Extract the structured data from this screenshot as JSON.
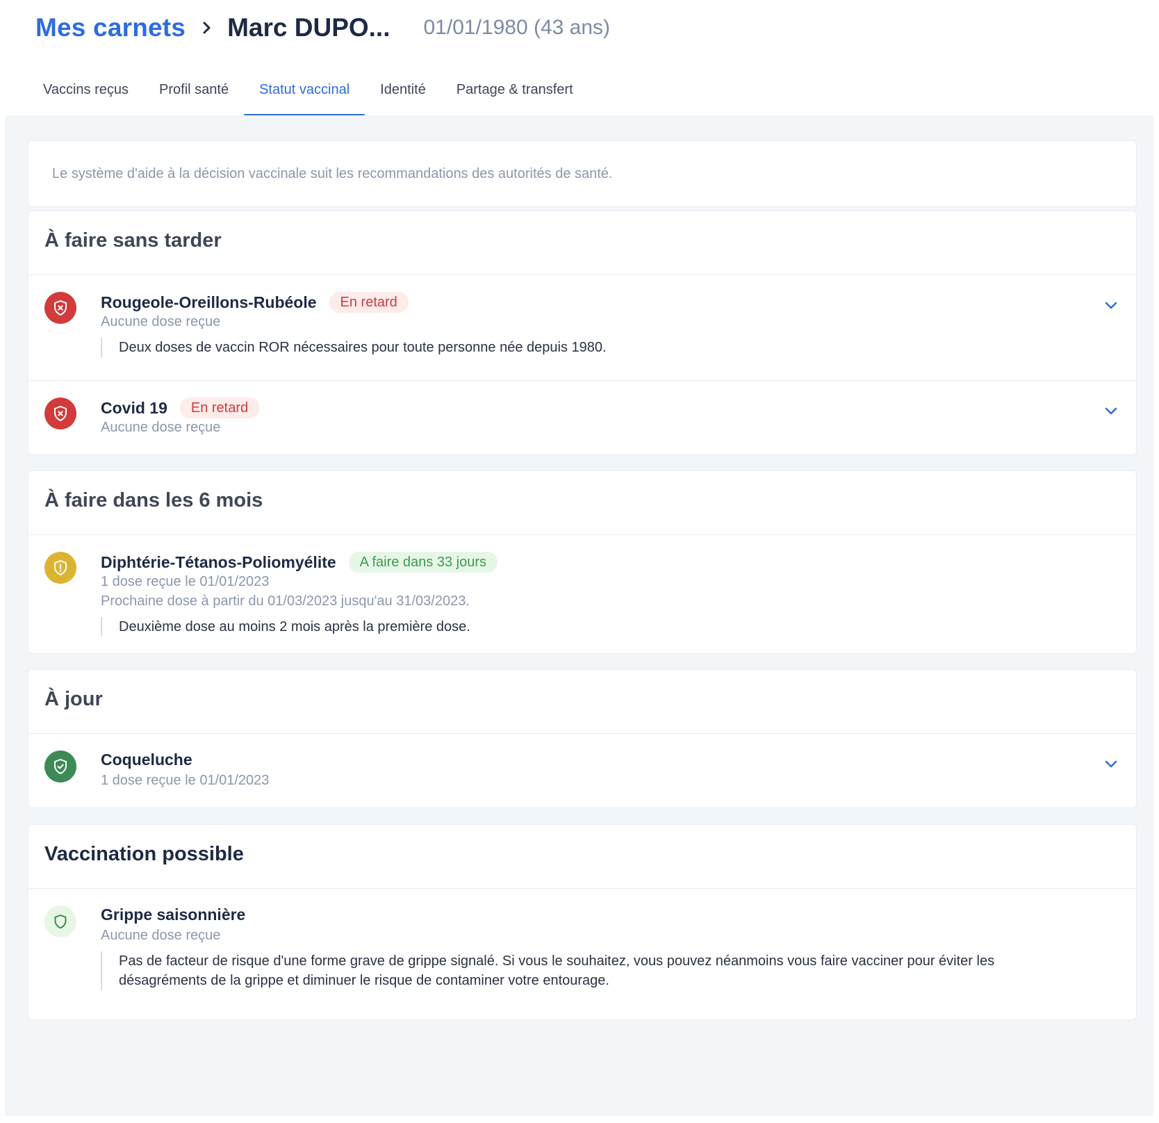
{
  "breadcrumb": {
    "root_label": "Mes carnets",
    "current_label": "Marc DUPO...",
    "birth_info": "01/01/1980 (43 ans)"
  },
  "tabs": [
    {
      "label": "Vaccins reçus",
      "active": false
    },
    {
      "label": "Profil santé",
      "active": false
    },
    {
      "label": "Statut vaccinal",
      "active": true
    },
    {
      "label": "Identité",
      "active": false
    },
    {
      "label": "Partage & transfert",
      "active": false
    }
  ],
  "info": {
    "text": "Le système d'aide à la décision vaccinale suit les recommandations des autorités de santé."
  },
  "sections": {
    "urgent": {
      "title": "À faire sans tarder",
      "items": [
        {
          "name": "Rougeole-Oreillons-Rubéole",
          "badge": "En retard",
          "status_line": "Aucune dose reçue",
          "note": "Deux doses de vaccin ROR nécessaires pour toute personne née depuis 1980.",
          "icon": "shield-x-icon"
        },
        {
          "name": "Covid 19",
          "badge": "En retard",
          "status_line": "Aucune dose reçue",
          "icon": "shield-x-icon"
        }
      ]
    },
    "six_months": {
      "title": "À faire dans les 6 mois",
      "items": [
        {
          "name": "Diphtérie-Tétanos-Poliomyélite",
          "badge": "A faire dans 33 jours",
          "status_line": "1 dose reçue le 01/01/2023",
          "next_line": "Prochaine dose à partir du 01/03/2023 jusqu'au 31/03/2023.",
          "note": "Deuxième dose au moins 2 mois après la première dose.",
          "icon": "shield-alert-icon"
        }
      ]
    },
    "up_to_date": {
      "title": "À jour",
      "items": [
        {
          "name": "Coqueluche",
          "status_line": "1 dose reçue le 01/01/2023",
          "icon": "shield-check-icon"
        }
      ]
    },
    "possible": {
      "title": "Vaccination possible",
      "items": [
        {
          "name": "Grippe saisonnière",
          "status_line": "Aucune dose reçue",
          "note_line1": "Pas de facteur de risque d'une forme grave de grippe signalé. Si vous le souhaitez, vous pouvez néanmoins vous faire vacciner pour éviter les",
          "note_line2": "désagréments de la grippe et diminuer le risque de contaminer votre entourage.",
          "icon": "shield-outline-icon"
        }
      ]
    }
  },
  "colors": {
    "accent": "#2d6cdf",
    "late": "#d13b3b",
    "soon": "#dcb431",
    "ok": "#3d8a57",
    "possible_bg": "#e8f6e6"
  }
}
